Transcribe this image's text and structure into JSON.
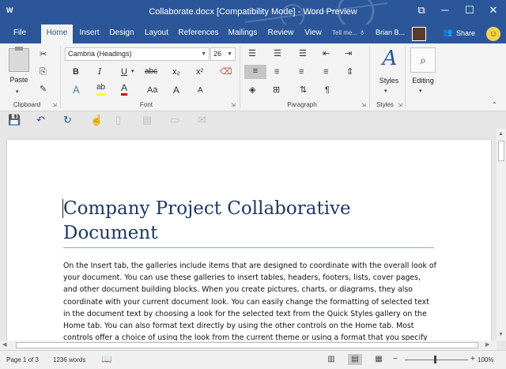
{
  "titlebar": {
    "app_icon": "W",
    "title": "Collaborate.docx [Compatibility Mode] - Word Preview",
    "restore_icon": "restore-icon",
    "minimize_icon": "minimize-icon",
    "maximize_icon": "maximize-icon",
    "close_icon": "close-icon",
    "color": "#2b579a"
  },
  "tabs": {
    "items": [
      "File",
      "Home",
      "Insert",
      "Design",
      "Layout",
      "References",
      "Mailings",
      "Review",
      "View"
    ],
    "active": "Home",
    "tell_me": "Tell me...",
    "user": "Brian B...",
    "share": "Share"
  },
  "ribbon": {
    "clipboard": {
      "label": "Clipboard",
      "paste": "Paste"
    },
    "font": {
      "label": "Font",
      "font_name": "Cambria (Headings)",
      "font_size": "26",
      "bold": "B",
      "italic": "I",
      "underline": "U",
      "strikethrough": "abc",
      "subscript": "x₂",
      "superscript": "x²",
      "text_effects": "A",
      "highlight": "ab",
      "font_color": "A",
      "change_case": "Aa",
      "grow_font": "A",
      "shrink_font": "A"
    },
    "paragraph": {
      "label": "Paragraph",
      "pilcrow": "¶"
    },
    "styles": {
      "label": "Styles",
      "button": "Styles"
    },
    "editing": {
      "button": "Editing"
    }
  },
  "document": {
    "title": "Company Project Collaborative Document",
    "body": "On the Insert tab, the galleries include items that are designed to coordinate with the overall look of your document. You can use these galleries to insert tables, headers, footers, lists, cover pages, and other document building blocks. When you create pictures, charts, or diagrams, they also coordinate with your current document look. You can easily change the formatting of selected text in the document text by choosing a look for the selected text from the Quick Styles gallery on the Home tab. You can also format text directly by using the other controls on the Home tab. Most controls offer a choice of using the look from the current theme or using a format that you specify directly. To change the overall look"
  },
  "status": {
    "page": "Page 1 of 3",
    "words": "1236 words",
    "zoom": "100%"
  }
}
